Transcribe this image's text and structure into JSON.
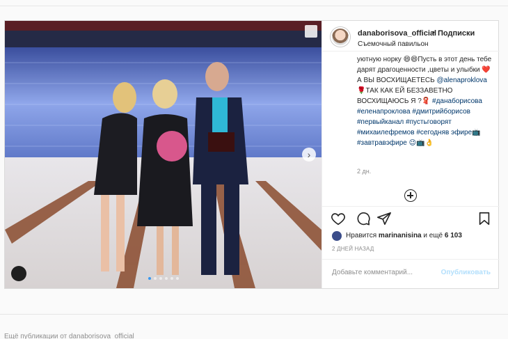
{
  "post": {
    "username": "danaborisova_official",
    "dot": "•",
    "follow_label": "Подписки",
    "location": "Съемочный павильон",
    "caption_partial": "уютную норку 😄😄Пусть в этот день тебе дарят драгоценности ,цветы и улыбки ❤️ А ВЫ ВОСХИЩАЕТЕСЬ",
    "mention": "@alenaproklova",
    "caption_rest": "🌹ТАК КАК ЕЙ БЕЗЗАВЕТНО ВОСХИЩАЮСЬ Я ?🧣",
    "hashtags": "#данаборисова #еленапроклова #дмитрийборисов #первыйканал #пустьговорят #михаилефремов #сегодняв эфире📺 #завтравэфире 😉📺👌",
    "time_ago_short": "2 дн.",
    "liked_by_prefix": "Нравится",
    "liked_by_user": "marinanisina",
    "liked_by_suffix": "и ещё",
    "likes_count": "6 103",
    "posted_ago": "2 ДНЕЙ НАЗАД",
    "comment_placeholder": "Добавьте комментарий...",
    "publish_label": "Опубликовать"
  },
  "carousel": {
    "slides": 6,
    "active_index": 0
  },
  "icons": {
    "like": "heart-icon",
    "comment": "comment-icon",
    "share": "paper-plane-icon",
    "save": "bookmark-icon",
    "add": "plus-circle-icon",
    "next": "chevron-right-icon"
  },
  "colors": {
    "link": "#00376b",
    "publish": "#b2dffc",
    "dot_active": "#3897f0"
  },
  "footer": {
    "text": "Ещё публикации от danaborisova_official"
  }
}
